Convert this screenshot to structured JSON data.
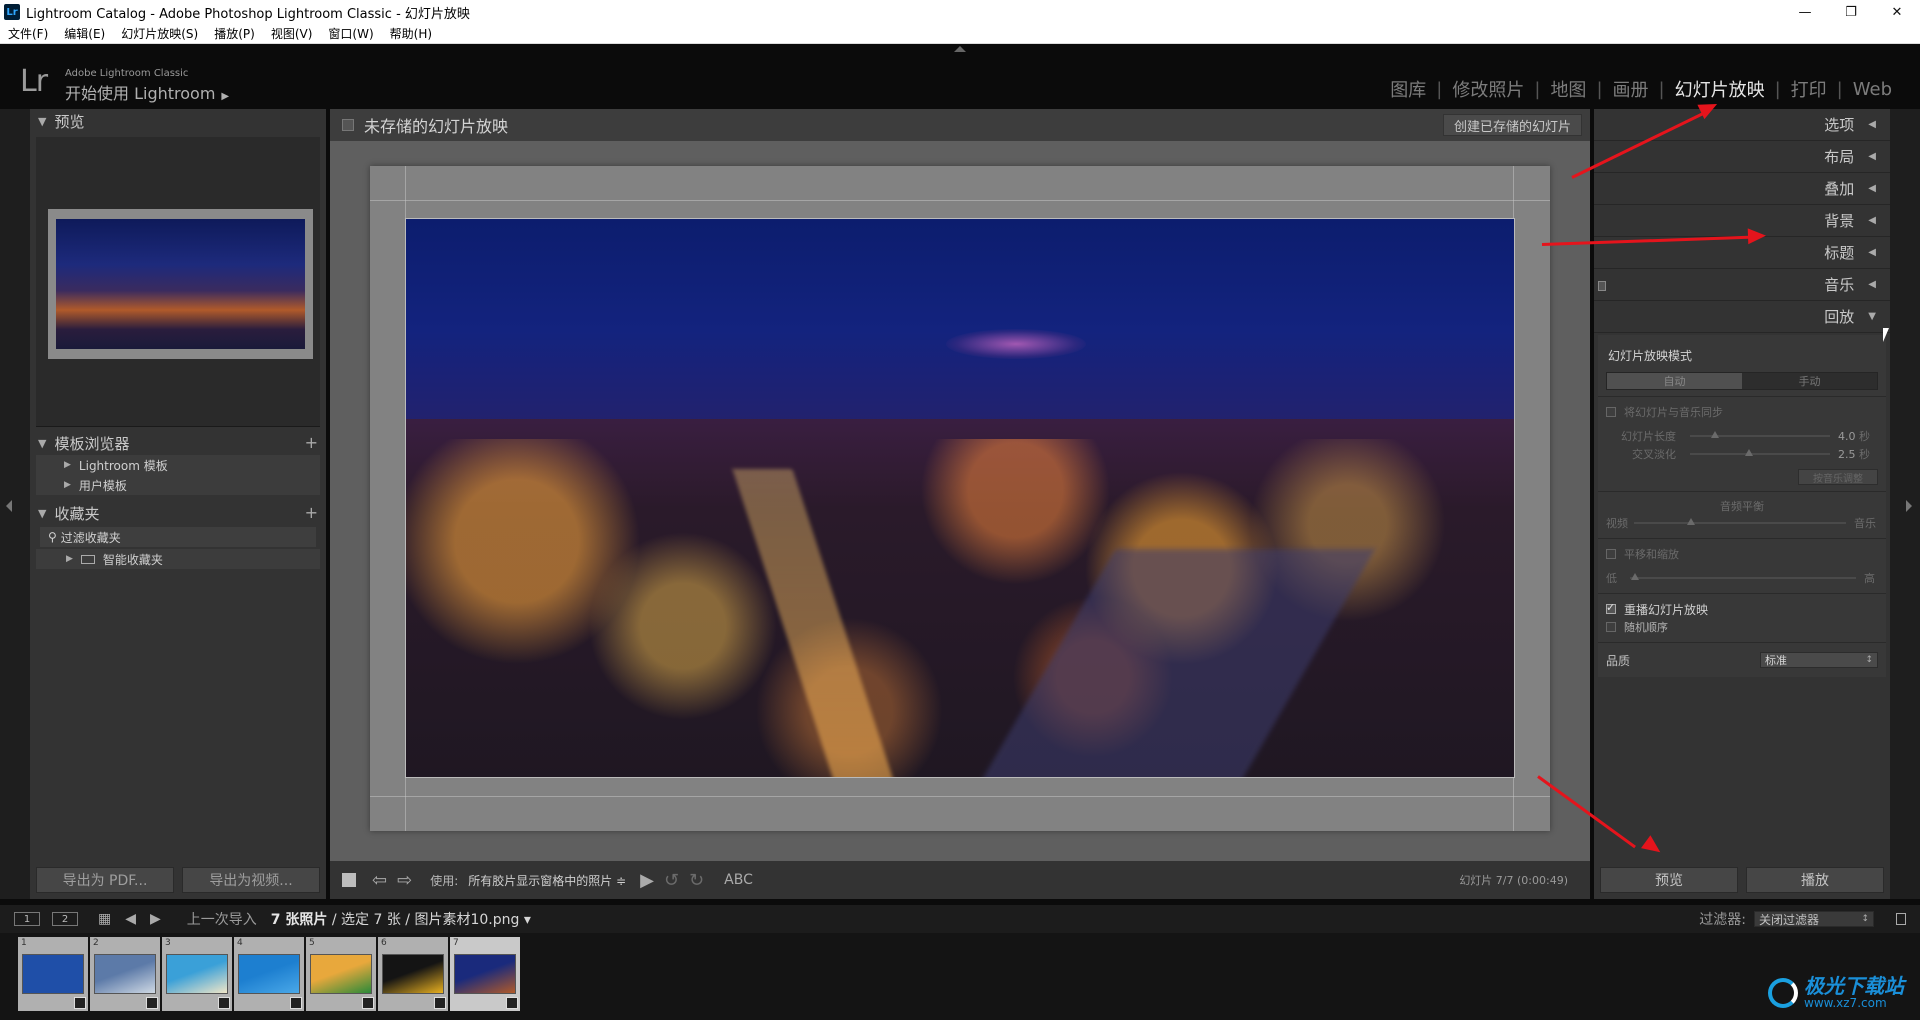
{
  "window": {
    "app_icon": "Lr",
    "title": "Lightroom Catalog - Adobe Photoshop Lightroom Classic - 幻灯片放映",
    "controls": [
      "—",
      "❐",
      "✕"
    ]
  },
  "menu": [
    "文件(F)",
    "编辑(E)",
    "幻灯片放映(S)",
    "播放(P)",
    "视图(V)",
    "窗口(W)",
    "帮助(H)"
  ],
  "identity": {
    "logo": "Lr",
    "brand_small": "Adobe Lightroom Classic",
    "brand_main": "开始使用 Lightroom",
    "brand_arrow": "▶"
  },
  "modules": [
    {
      "label": "图库",
      "active": false
    },
    {
      "label": "修改照片",
      "active": false
    },
    {
      "label": "地图",
      "active": false
    },
    {
      "label": "画册",
      "active": false
    },
    {
      "label": "幻灯片放映",
      "active": true
    },
    {
      "label": "打印",
      "active": false
    },
    {
      "label": "Web",
      "active": false
    }
  ],
  "left": {
    "preview_header": "预览",
    "template_header": "模板浏览器",
    "template_items": [
      "Lightroom 模板",
      "用户模板"
    ],
    "collections_header": "收藏夹",
    "filter_label": "过滤收藏夹",
    "smart_collection": "智能收藏夹",
    "export_pdf": "导出为 PDF...",
    "export_video": "导出为视频..."
  },
  "center": {
    "title": "未存储的幻灯片放映",
    "create_saved": "创建已存储的幻灯片",
    "use_label": "使用:",
    "use_value": "所有胶片显示窗格中的照片 ≑",
    "abc": "ABC",
    "slide_info": "幻灯片 7/7 (0:00:49)"
  },
  "right": {
    "panels": [
      "选项",
      "布局",
      "叠加",
      "背景",
      "标题",
      "音乐",
      "回放"
    ],
    "playback": {
      "mode_label": "幻灯片放映模式",
      "mode_auto": "自动",
      "mode_manual": "手动",
      "sync_music": "将幻灯片与音乐同步",
      "slide_length_label": "幻灯片长度",
      "slide_length_value": "4.0",
      "slide_length_unit": "秒",
      "slide_length_fraction": 0.18,
      "crossfade_label": "交叉淡化",
      "crossfade_value": "2.5",
      "crossfade_unit": "秒",
      "crossfade_fraction": 0.42,
      "fit_music_btn": "按音乐调整",
      "audio_balance": "音频平衡",
      "video_label": "视频",
      "music_label": "音乐",
      "audio_balance_fraction": 0.27,
      "pan_zoom": "平移和缩放",
      "low_label": "低",
      "high_label": "高",
      "pan_zoom_fraction": 0.02,
      "repeat": "重播幻灯片放映",
      "repeat_checked": true,
      "random": "随机顺序",
      "quality_label": "品质",
      "quality_value": "标准"
    },
    "preview_btn": "预览",
    "play_btn": "播放"
  },
  "filmnav": {
    "view1": "1",
    "view2": "2",
    "source": "上一次导入",
    "count_bold": "7 张照片",
    "count_rest": " / 选定 7 张 / 图片素材10.png ▾",
    "filter_label": "过滤器:",
    "filter_value": "关闭过滤器"
  },
  "filmstrip": [
    {
      "num": "1",
      "colors": [
        "#1f4fa8",
        "#1f4fa8"
      ]
    },
    {
      "num": "2",
      "colors": [
        "#5c7aa8",
        "#cfd9e4"
      ]
    },
    {
      "num": "3",
      "colors": [
        "#3aa0d8",
        "#f0e6c8"
      ]
    },
    {
      "num": "4",
      "colors": [
        "#1d7fd0",
        "#4aa8e8"
      ]
    },
    {
      "num": "5",
      "colors": [
        "#e8a83c",
        "#2a8a3a"
      ]
    },
    {
      "num": "6",
      "colors": [
        "#141414",
        "#e8b020"
      ]
    },
    {
      "num": "7",
      "colors": [
        "#1a2a7c",
        "#b05a2a"
      ]
    }
  ],
  "watermark": {
    "text": "极光下载站",
    "url": "www.xz7.com"
  },
  "colors": {
    "accent_red": "#e5141c",
    "panel": "#333333",
    "active_module": "#e6e6e6"
  }
}
